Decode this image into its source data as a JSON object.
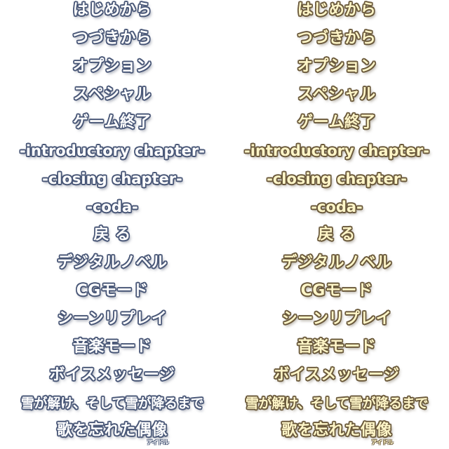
{
  "menu_items": [
    "はじめから",
    "つづきから",
    "オプション",
    "スペシャル",
    "ゲーム終了",
    "-introductory chapter-",
    "-closing chapter-",
    "-coda-",
    "戻 る",
    "デジタルノベル",
    "CGモード",
    "シーンリプレイ",
    "音楽モード",
    "ボイスメッセージ",
    "雪が解け、そして雪が降るまで",
    "歌を忘れた偶像"
  ],
  "ruby": {
    "idol": "アイドル"
  },
  "colors": {
    "normal_fill": "#ffffff",
    "normal_outline": "#4a5878",
    "hover_fill": "#fff6c8",
    "hover_outline": "#6b5a3c"
  }
}
